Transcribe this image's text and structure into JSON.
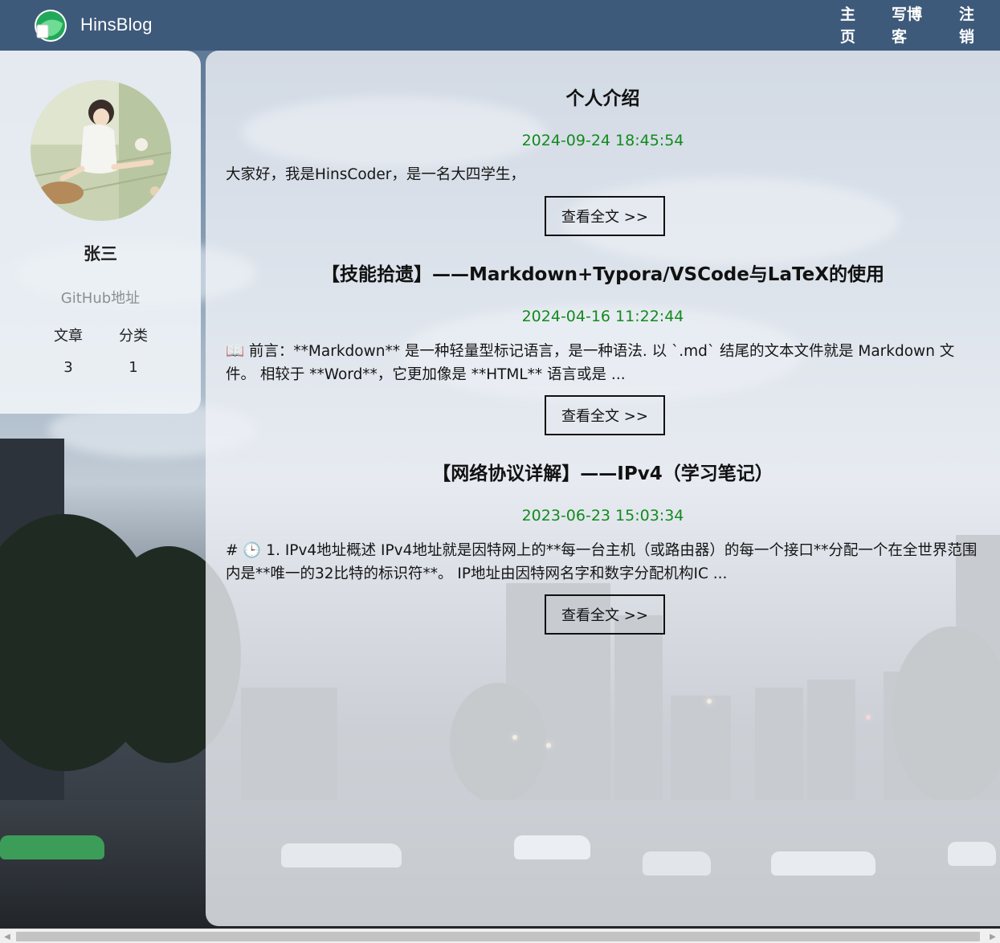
{
  "navbar": {
    "brand": "HinsBlog",
    "logo_icon": "hinsblog-logo-icon",
    "items": [
      {
        "label": "主页"
      },
      {
        "label": "写博客"
      },
      {
        "label": "注销"
      }
    ],
    "background_color": "#3c5878"
  },
  "profile": {
    "username": "张三",
    "github_label": "GitHub地址",
    "stats": {
      "articles_label": "文章",
      "articles_value": "3",
      "categories_label": "分类",
      "categories_value": "1"
    }
  },
  "posts": [
    {
      "title": "个人介绍",
      "date": "2024-09-24 18:45:54",
      "excerpt": "大家好，我是HinsCoder，是一名大四学生，",
      "read_more": "查看全文 >>"
    },
    {
      "title": "【技能拾遗】——Markdown+Typora/VSCode与LaTeX的使用",
      "date": "2024-04-16 11:22:44",
      "excerpt": "📖 前言：**Markdown** 是一种轻量型标记语言，是一种语法. 以 `.md` 结尾的文本文件就是 Markdown 文件。 相较于 **Word**，它更加像是 **HTML** 语言或是 ...",
      "read_more": "查看全文 >>"
    },
    {
      "title": "【网络协议详解】——IPv4（学习笔记）",
      "date": "2023-06-23 15:03:34",
      "excerpt": "# 🕒 1. IPv4地址概述 IPv4地址就是因特网上的**每一台主机（或路由器）的每一个接口**分配一个在全世界范围内是**唯一的32比特的标识符**。 IP地址由因特网名字和数字分配机构IC ...",
      "read_more": "查看全文 >>"
    }
  ],
  "colors": {
    "date_green": "#138a1e",
    "panel_bg": "#f0f3f7"
  }
}
